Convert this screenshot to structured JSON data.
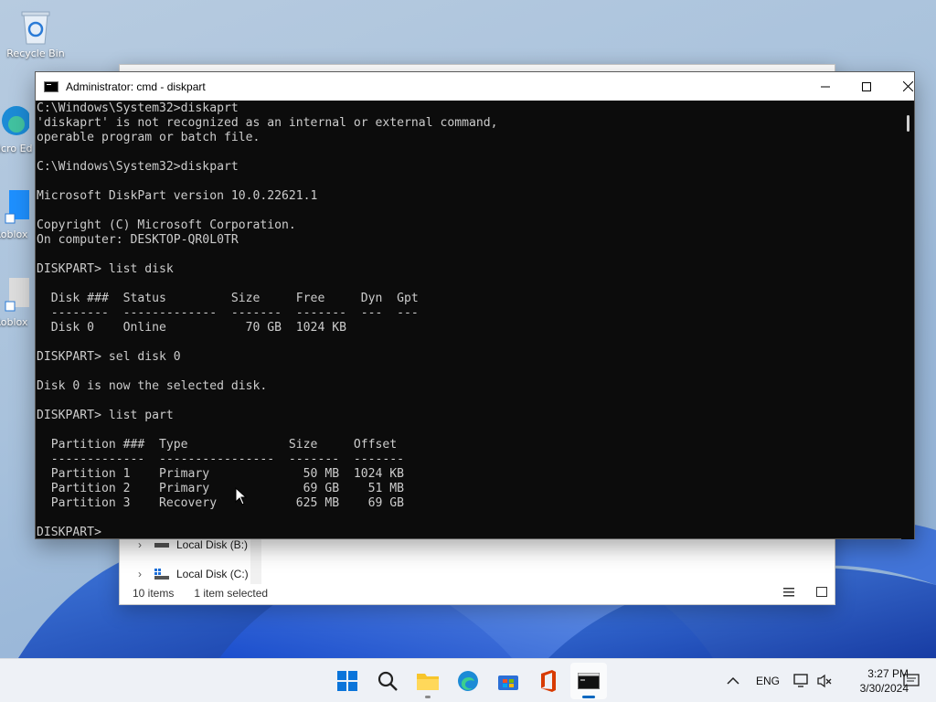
{
  "desktop": {
    "icons": [
      {
        "label": "Recycle Bin"
      },
      {
        "label": "Micro Ed"
      },
      {
        "label": "Roblox"
      },
      {
        "label": "Roblox"
      }
    ]
  },
  "explorer": {
    "tree": [
      {
        "label": "Local Disk (B:)"
      },
      {
        "label": "Local Disk (C:)"
      }
    ],
    "status": {
      "items": "10 items",
      "selected": "1 item selected"
    }
  },
  "cmd": {
    "title": "Administrator: cmd - diskpart",
    "lines": [
      "C:\\Windows\\System32>diskaprt",
      "'diskaprt' is not recognized as an internal or external command,",
      "operable program or batch file.",
      "",
      "C:\\Windows\\System32>diskpart",
      "",
      "Microsoft DiskPart version 10.0.22621.1",
      "",
      "Copyright (C) Microsoft Corporation.",
      "On computer: DESKTOP-QR0L0TR",
      "",
      "DISKPART> list disk",
      "",
      "  Disk ###  Status         Size     Free     Dyn  Gpt",
      "  --------  -------------  -------  -------  ---  ---",
      "  Disk 0    Online           70 GB  1024 KB",
      "",
      "DISKPART> sel disk 0",
      "",
      "Disk 0 is now the selected disk.",
      "",
      "DISKPART> list part",
      "",
      "  Partition ###  Type              Size     Offset",
      "  -------------  ----------------  -------  -------",
      "  Partition 1    Primary             50 MB  1024 KB",
      "  Partition 2    Primary             69 GB    51 MB",
      "  Partition 3    Recovery           625 MB    69 GB",
      "",
      "DISKPART> "
    ]
  },
  "taskbar": {
    "apps": [
      "start",
      "search",
      "file-explorer",
      "edge",
      "store",
      "office",
      "terminal"
    ],
    "tray": {
      "language": "ENG",
      "time": "3:27 PM",
      "date": "3/30/2024"
    }
  },
  "colors": {
    "console_bg": "#0c0c0c",
    "console_fg": "#cccccc",
    "accent": "#0067c0"
  }
}
